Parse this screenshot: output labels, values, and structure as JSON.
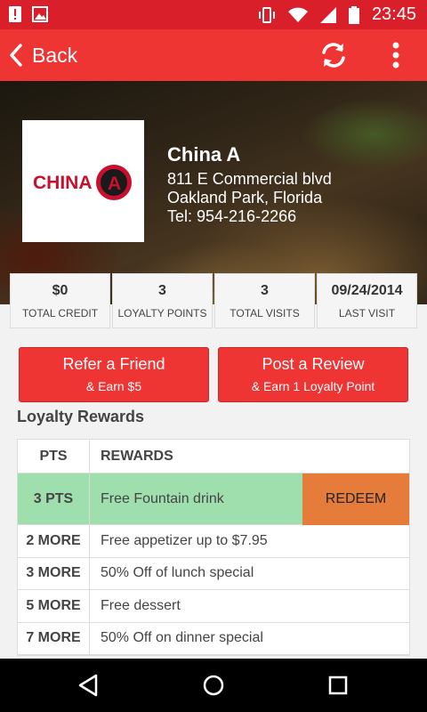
{
  "status_bar": {
    "time": "23:45"
  },
  "app_bar": {
    "back_label": "Back"
  },
  "restaurant": {
    "name": "China A",
    "address": "811 E Commercial blvd",
    "city": "Oakland Park, Florida",
    "phone": "Tel: 954-216-2266",
    "logo_text": "CHINA A"
  },
  "stats": [
    {
      "value": "$0",
      "label": "TOTAL CREDIT"
    },
    {
      "value": "3",
      "label": "LOYALTY POINTS"
    },
    {
      "value": "3",
      "label": "TOTAL VISITS"
    },
    {
      "value": "09/24/2014",
      "label": "LAST VISIT"
    }
  ],
  "buttons": {
    "refer": {
      "main": "Refer a Friend",
      "sub": "& Earn $5"
    },
    "review": {
      "main": "Post a Review",
      "sub": "& Earn 1 Loyalty Point"
    }
  },
  "loyalty": {
    "title": "Loyalty Rewards",
    "headers": {
      "pts": "PTS",
      "rewards": "REWARDS"
    },
    "redeem_label": "REDEEM",
    "rows": [
      {
        "pts": "3 PTS",
        "reward": "Free Fountain drink"
      },
      {
        "pts": "2 MORE",
        "reward": "Free appetizer up to $7.95"
      },
      {
        "pts": "3 MORE",
        "reward": "50% Off of lunch special"
      },
      {
        "pts": "5 MORE",
        "reward": "Free dessert"
      },
      {
        "pts": "7 MORE",
        "reward": "50% Off on dinner special"
      }
    ]
  },
  "colors": {
    "primary": "#ef3434",
    "status": "#d9202a",
    "available": "#9fdfae",
    "redeem": "#e57c3a"
  },
  "icons": [
    "alert-icon",
    "image-icon",
    "vibrate-icon",
    "wifi-icon",
    "signal-icon",
    "battery-icon",
    "back-chevron-icon",
    "refresh-icon",
    "more-vert-icon",
    "nav-back-icon",
    "nav-home-icon",
    "nav-recents-icon"
  ]
}
